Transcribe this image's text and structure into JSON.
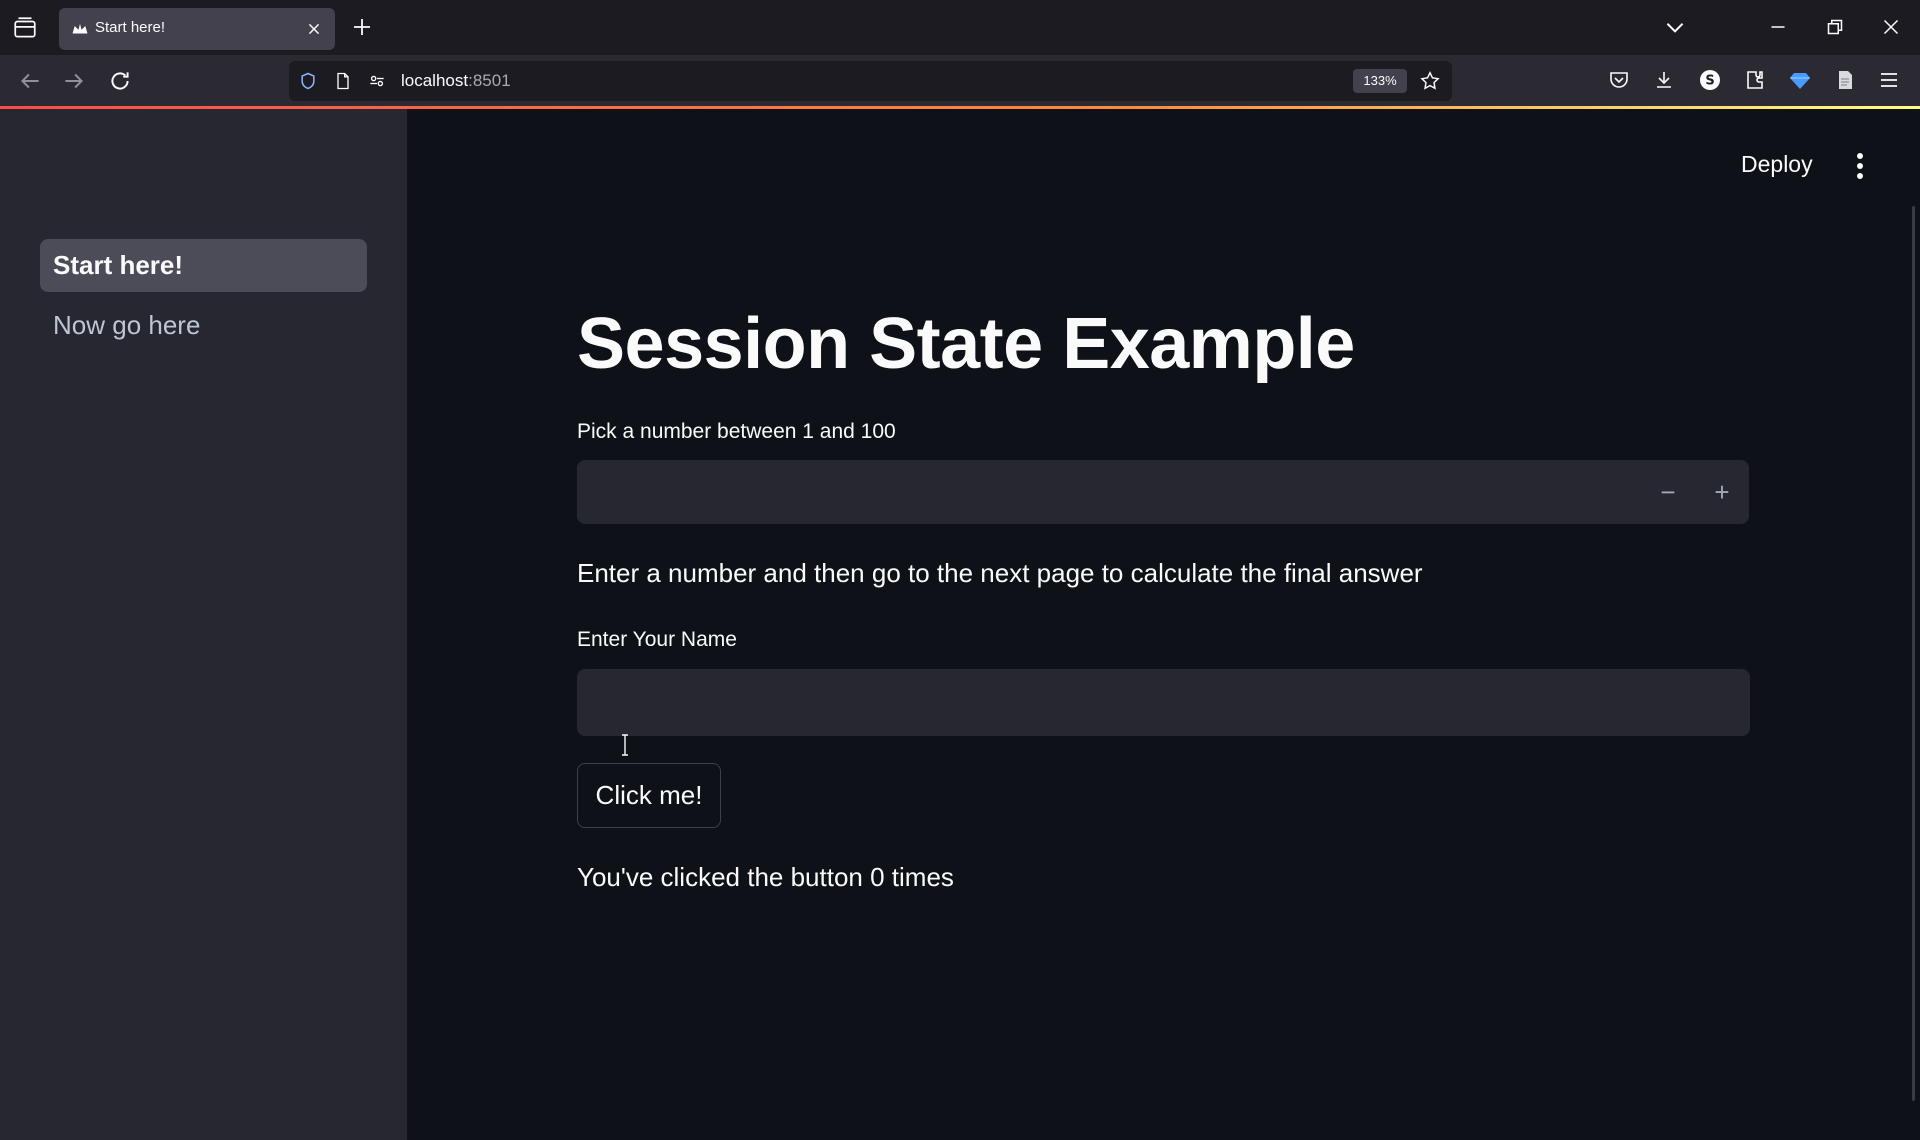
{
  "browser": {
    "tab_title": "Start here!",
    "url_host": "localhost",
    "url_port": ":8501",
    "zoom_level": "133%"
  },
  "sidebar": {
    "items": [
      {
        "label": "Start here!",
        "active": true
      },
      {
        "label": "Now go here",
        "active": false
      }
    ]
  },
  "header": {
    "deploy_label": "Deploy"
  },
  "main": {
    "title": "Session State Example",
    "number_label": "Pick a number between 1 and 100",
    "number_value": "",
    "instruction": "Enter a number and then go to the next page to calculate the final answer",
    "name_label": "Enter Your Name",
    "name_value": "",
    "button_label": "Click me!",
    "click_status": "You've clicked the button 0 times"
  },
  "colors": {
    "accent": "#ff4b4b",
    "background": "#0e1117",
    "sidebar": "#262730"
  }
}
